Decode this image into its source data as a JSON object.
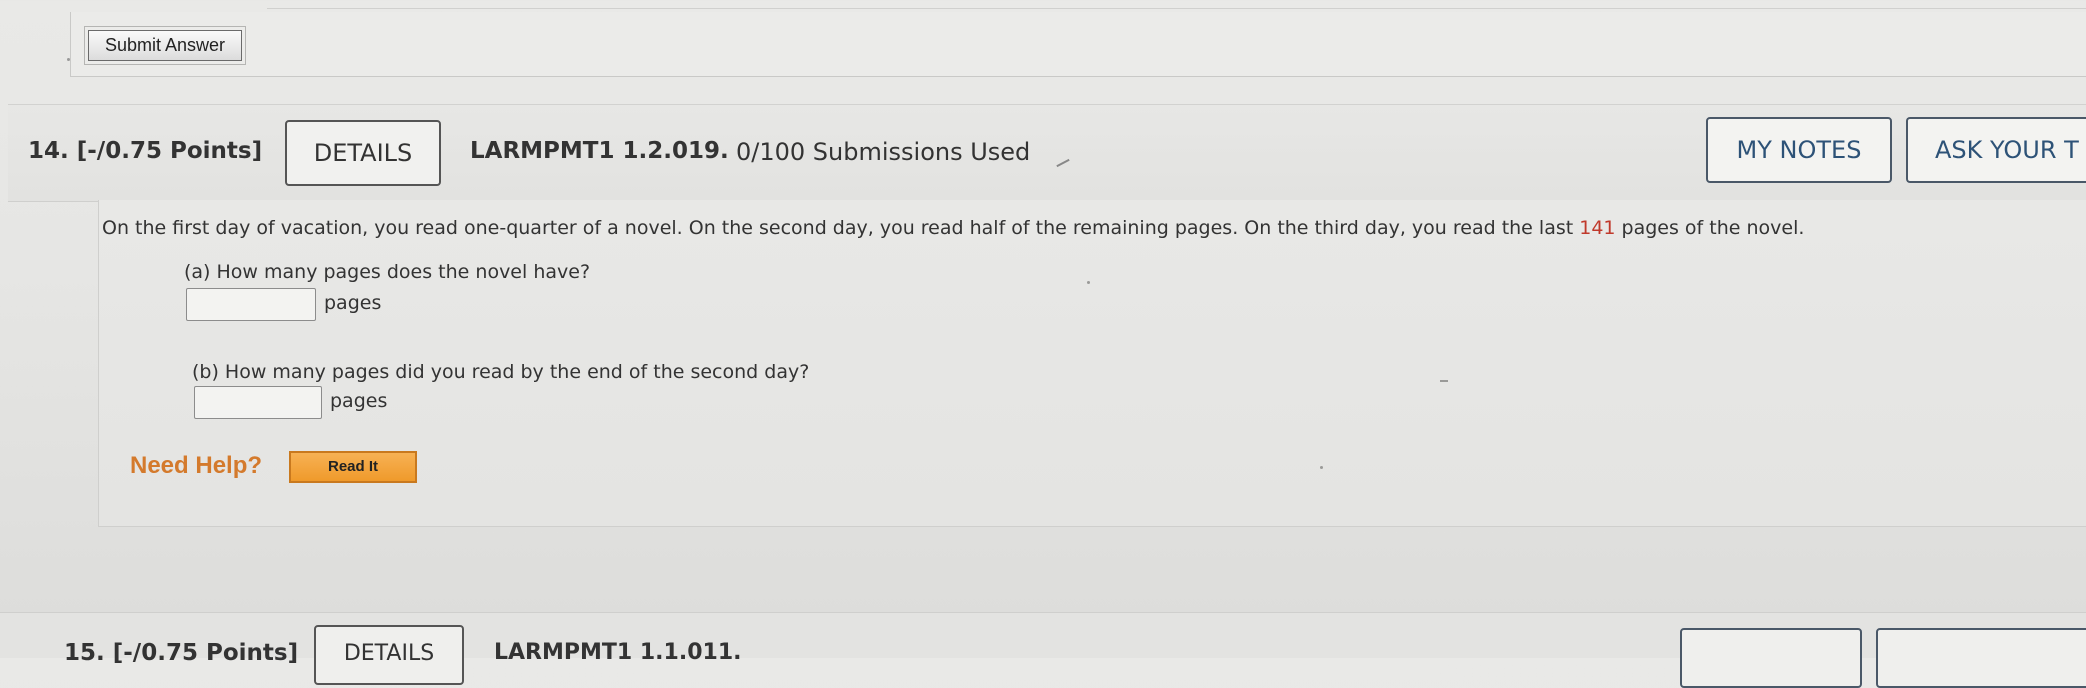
{
  "previous_question": {
    "submit_label": "Submit Answer"
  },
  "question": {
    "number_points": "14.  [-/0.75 Points]",
    "details_label": "DETAILS",
    "code": "LARMPMT1 1.2.019.",
    "submissions": "0/100 Submissions Used",
    "my_notes_label": "MY NOTES",
    "ask_teacher_label": "ASK YOUR T",
    "text_before": "On the first day of vacation, you read one-quarter of a novel. On the second day, you read half of the remaining pages. On the third day, you read the last ",
    "highlight_value": "141",
    "text_after": " pages of the novel.",
    "part_a": {
      "label": "(a) How many pages does the novel have?",
      "value": "",
      "unit": "pages"
    },
    "part_b": {
      "label": "(b) How many pages did you read by the end of the second day?",
      "value": "",
      "unit": "pages"
    },
    "need_help_label": "Need Help?",
    "read_it_label": "Read It"
  },
  "next_question": {
    "number_points": "15.  [-/0.75 Points]",
    "details_label": "DETAILS",
    "code": "LARMPMT1 1.1.011."
  },
  "colors": {
    "highlight": "#c0392b",
    "need_help": "#d47a2c",
    "read_it_bg": "#ef9a2b",
    "notes_text": "#2d5277"
  }
}
